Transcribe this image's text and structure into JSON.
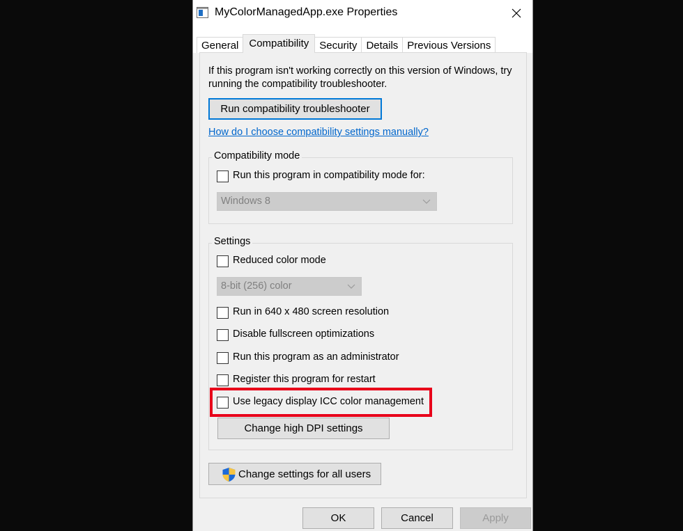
{
  "window": {
    "title": "MyColorManagedApp.exe Properties",
    "close_glyph": "✕"
  },
  "tabs": [
    {
      "label": "General"
    },
    {
      "label": "Compatibility",
      "active": true
    },
    {
      "label": "Security"
    },
    {
      "label": "Details"
    },
    {
      "label": "Previous Versions"
    }
  ],
  "intro_text": "If this program isn't working correctly on this version of Windows, try running the compatibility troubleshooter.",
  "troubleshooter_button": "Run compatibility troubleshooter",
  "manual_link": "How do I choose compatibility settings manually?",
  "compat_mode": {
    "group_label": "Compatibility mode",
    "checkbox_label": "Run this program in compatibility mode for:",
    "checked": false,
    "select_value": "Windows 8"
  },
  "settings": {
    "group_label": "Settings",
    "reduced_color": {
      "label": "Reduced color mode",
      "checked": false
    },
    "color_select_value": "8-bit (256) color",
    "res_640": {
      "label": "Run in 640 x 480 screen resolution",
      "checked": false
    },
    "fullscreen_opt": {
      "label": "Disable fullscreen optimizations",
      "checked": false
    },
    "run_admin": {
      "label": "Run this program as an administrator",
      "checked": false
    },
    "register_restart": {
      "label": "Register this program for restart",
      "checked": false
    },
    "legacy_icc": {
      "label": "Use legacy display ICC color management",
      "checked": false
    },
    "dpi_button": "Change high DPI settings"
  },
  "all_users_button": "Change settings for all users",
  "footer": {
    "ok": "OK",
    "cancel": "Cancel",
    "apply": "Apply"
  },
  "colors": {
    "accent": "#0078d7",
    "link": "#0066cc",
    "highlight": "#e8001a"
  }
}
